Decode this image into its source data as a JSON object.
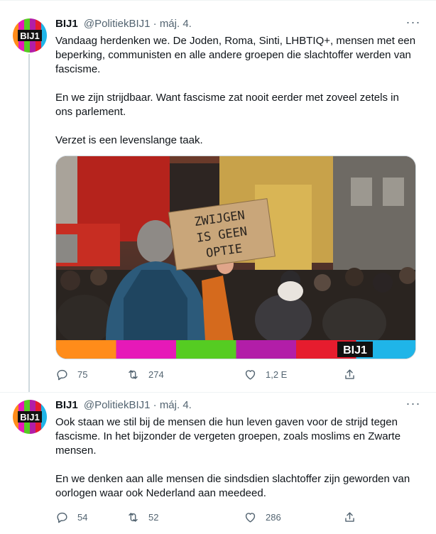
{
  "tweets": [
    {
      "author": {
        "name": "BIJ1",
        "handle": "@PolitiekBIJ1",
        "date": "máj. 4.",
        "avatar_text": "BIJ1"
      },
      "paragraphs": [
        "Vandaag herdenken we. De Joden, Roma, Sinti, LHBTIQ+, mensen met een beperking, communisten en alle andere groepen die slachtoffer werden van fascisme.",
        "En we zijn strijdbaar. Want fascisme zat nooit eerder met zoveel zetels in ons parlement.",
        "Verzet is een levenslange taak."
      ],
      "media": {
        "sign_lines": [
          "ZWIJGEN",
          "IS GEEN",
          "OPTIE"
        ],
        "logo_text": "BIJ1",
        "stripe_colors": [
          "#ff8c1a",
          "#e619b8",
          "#55cc22",
          "#b21ea8",
          "#e61c2e",
          "#1fb5e8"
        ]
      },
      "stats": {
        "replies": "75",
        "retweets": "274",
        "likes": "1,2 E"
      }
    },
    {
      "author": {
        "name": "BIJ1",
        "handle": "@PolitiekBIJ1",
        "date": "máj. 4.",
        "avatar_text": "BIJ1"
      },
      "paragraphs": [
        "Ook staan we stil bij de mensen die hun leven gaven voor de strijd tegen fascisme. In het bijzonder de vergeten groepen, zoals moslims en Zwarte mensen.",
        "En we denken aan alle mensen die sindsdien slachtoffer zijn geworden van oorlogen waar ook Nederland aan meedeed."
      ],
      "stats": {
        "replies": "54",
        "retweets": "52",
        "likes": "286"
      }
    }
  ],
  "ui": {
    "more_glyph": "···",
    "separator": " · "
  },
  "colors": {
    "text": "#0f1419",
    "secondary": "#536471",
    "border": "#cfd9de"
  }
}
